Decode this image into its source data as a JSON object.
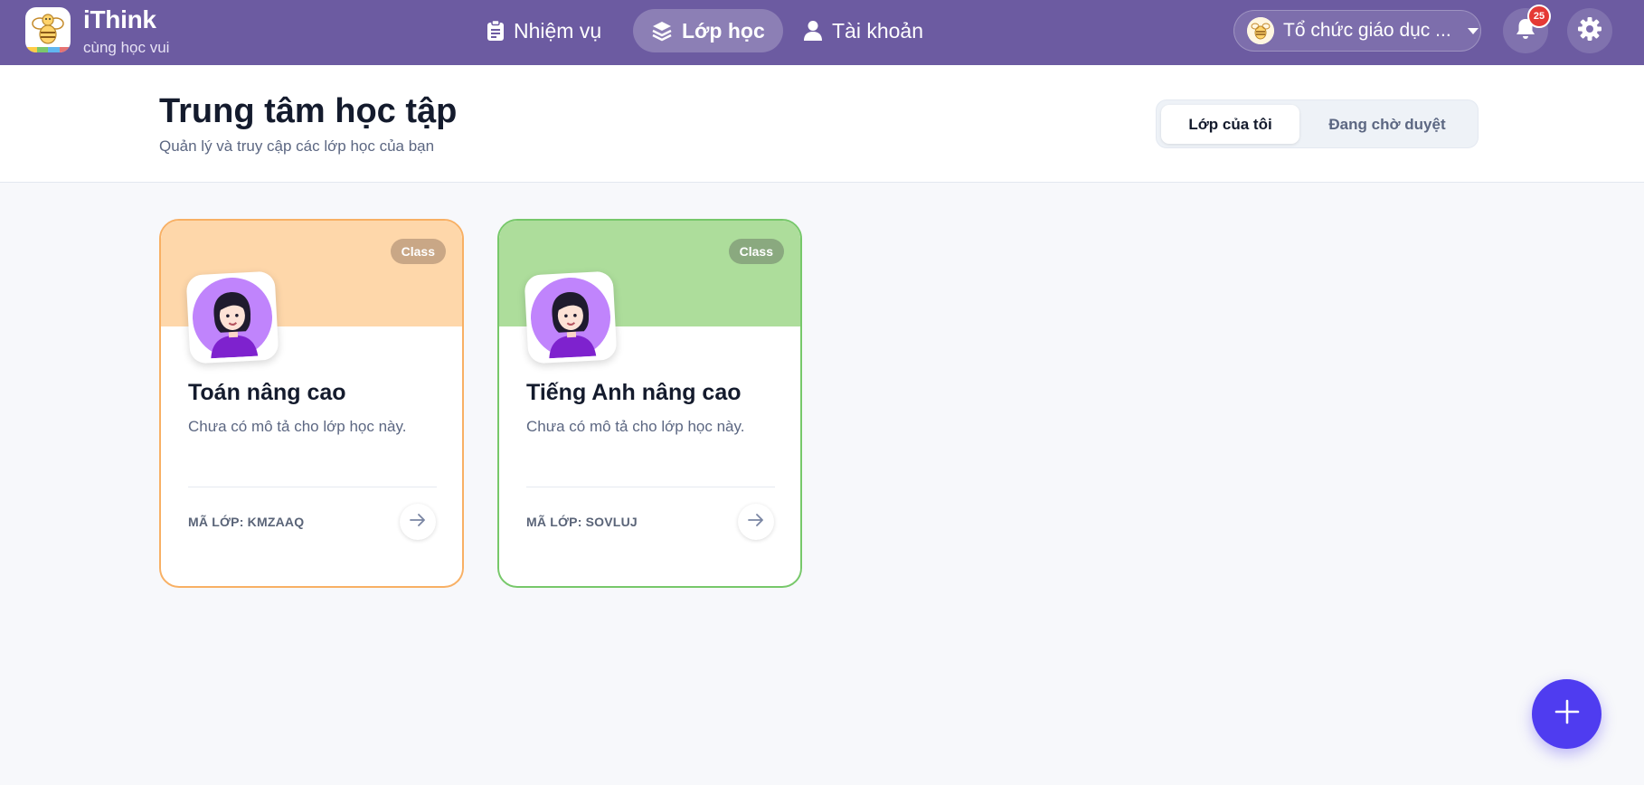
{
  "brand": {
    "name": "iThink",
    "tagline": "cùng học vui",
    "logo_icon": "bee-logo-icon"
  },
  "nav": {
    "items": [
      {
        "label": "Nhiệm vụ",
        "icon": "clipboard-icon",
        "active": false
      },
      {
        "label": "Lớp học",
        "icon": "layers-icon",
        "active": true
      },
      {
        "label": "Tài khoản",
        "icon": "user-icon",
        "active": false
      }
    ]
  },
  "topbar": {
    "organization": "Tổ chức giáo dục ...",
    "notification_count": "25",
    "accent": "#6c5ba1"
  },
  "header": {
    "title": "Trung tâm học tập",
    "subtitle": "Quản lý và truy cập các lớp học của bạn",
    "tabs": [
      {
        "label": "Lớp của tôi",
        "active": true
      },
      {
        "label": "Đang chờ duyệt",
        "active": false
      }
    ]
  },
  "classes": [
    {
      "tag": "Class",
      "title": "Toán nâng cao",
      "description": "Chưa có mô tả cho lớp học này.",
      "code": "MÃ LỚP: KMZAAQ",
      "banner_color": "#fed7aa",
      "border_color": "#f8b064"
    },
    {
      "tag": "Class",
      "title": "Tiếng Anh nâng cao",
      "description": "Chưa có mô tả cho lớp học này.",
      "code": "MÃ LỚP: SOVLUJ",
      "banner_color": "#addd9b",
      "border_color": "#77c86a"
    }
  ],
  "fab": {
    "icon": "plus-icon",
    "color": "#4f3cf0"
  }
}
